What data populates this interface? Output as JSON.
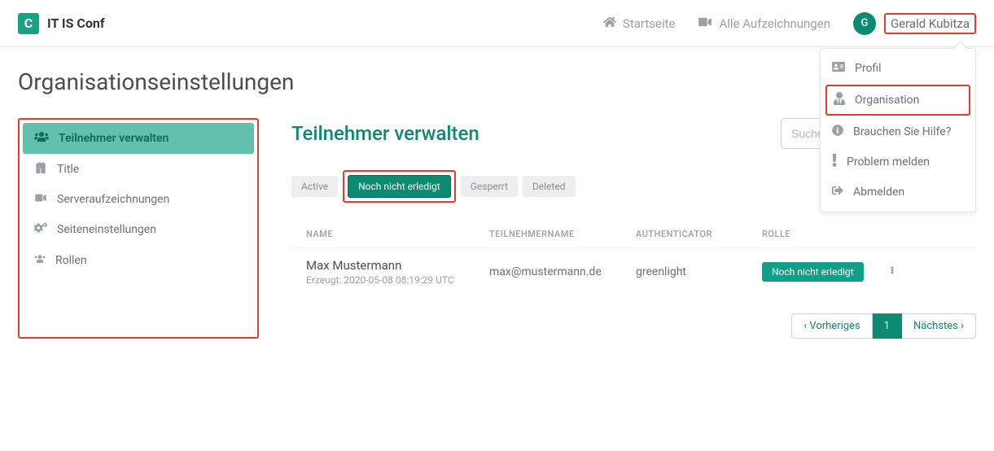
{
  "brand": {
    "logo_letter": "C",
    "name": "IT IS Conf"
  },
  "nav": {
    "home": "Startseite",
    "recordings": "Alle Aufzeichnungen"
  },
  "user": {
    "initial": "G",
    "name": "Gerald Kubitza"
  },
  "dropdown": {
    "profile": "Profil",
    "organisation": "Organisation",
    "help": "Brauchen Sie Hilfe?",
    "report": "Problem melden",
    "logout": "Abmelden"
  },
  "page": {
    "title": "Organisationseinstellungen"
  },
  "sidebar": {
    "items": [
      {
        "label": "Teilnehmer verwalten"
      },
      {
        "label": "Title"
      },
      {
        "label": "Serveraufzeichnungen"
      },
      {
        "label": "Seiteneinstellungen"
      },
      {
        "label": "Rollen"
      }
    ]
  },
  "panel": {
    "title": "Teilnehmer verwalten",
    "search_placeholder": "Suche..."
  },
  "filters": {
    "active": "Active",
    "pending": "Noch nicht erledigt",
    "banned": "Gesperrt",
    "deleted": "Deleted"
  },
  "table": {
    "headers": {
      "name": "NAME",
      "username": "TEILNEHMERNAME",
      "authenticator": "AUTHENTICATOR",
      "role": "ROLLE"
    },
    "rows": [
      {
        "name": "Max Mustermann",
        "created_label": "Erzeugt: 2020-05-08 08:19:29 UTC",
        "username": "max@mustermann.de",
        "authenticator": "greenlight",
        "role": "Noch nicht erledigt"
      }
    ]
  },
  "pagination": {
    "prev": "‹ Vorheriges",
    "page1": "1",
    "next": "Nächstes ›"
  }
}
